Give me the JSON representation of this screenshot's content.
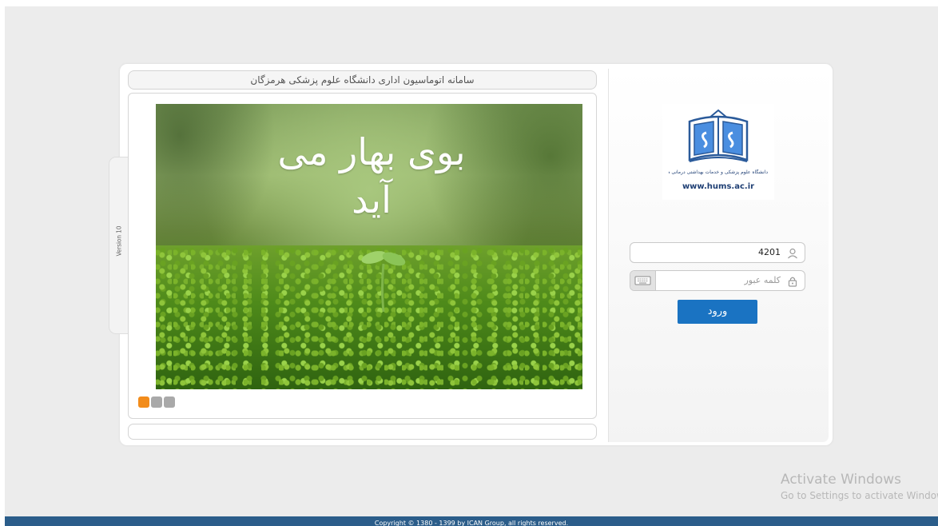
{
  "header": {
    "title": "سامانه اتوماسیون اداری دانشگاه علوم پزشکی هرمزگان"
  },
  "version_label": "Version 10",
  "slideshow": {
    "caption": "بوی بهار می آید",
    "dot_count": 3,
    "active_dot": 0
  },
  "logo": {
    "url_text": "www.hums.ac.ir",
    "tagline": "دانشگاه علوم پزشکی و خدمات بهداشتی درمانی هرمزگان"
  },
  "login": {
    "username_value": "4201",
    "password_placeholder": "کلمه عبور",
    "submit_label": "ورود"
  },
  "watermark": {
    "line1": "Activate Windows",
    "line2": "Go to Settings to activate Windows."
  },
  "footer": {
    "copyright": "Copyright © 1380 - 1399 by ICAN Group, all rights reserved."
  },
  "colors": {
    "accent": "#1a73c2",
    "active_dot": "#f28c1b",
    "footer_bg": "#2b5d8a"
  }
}
